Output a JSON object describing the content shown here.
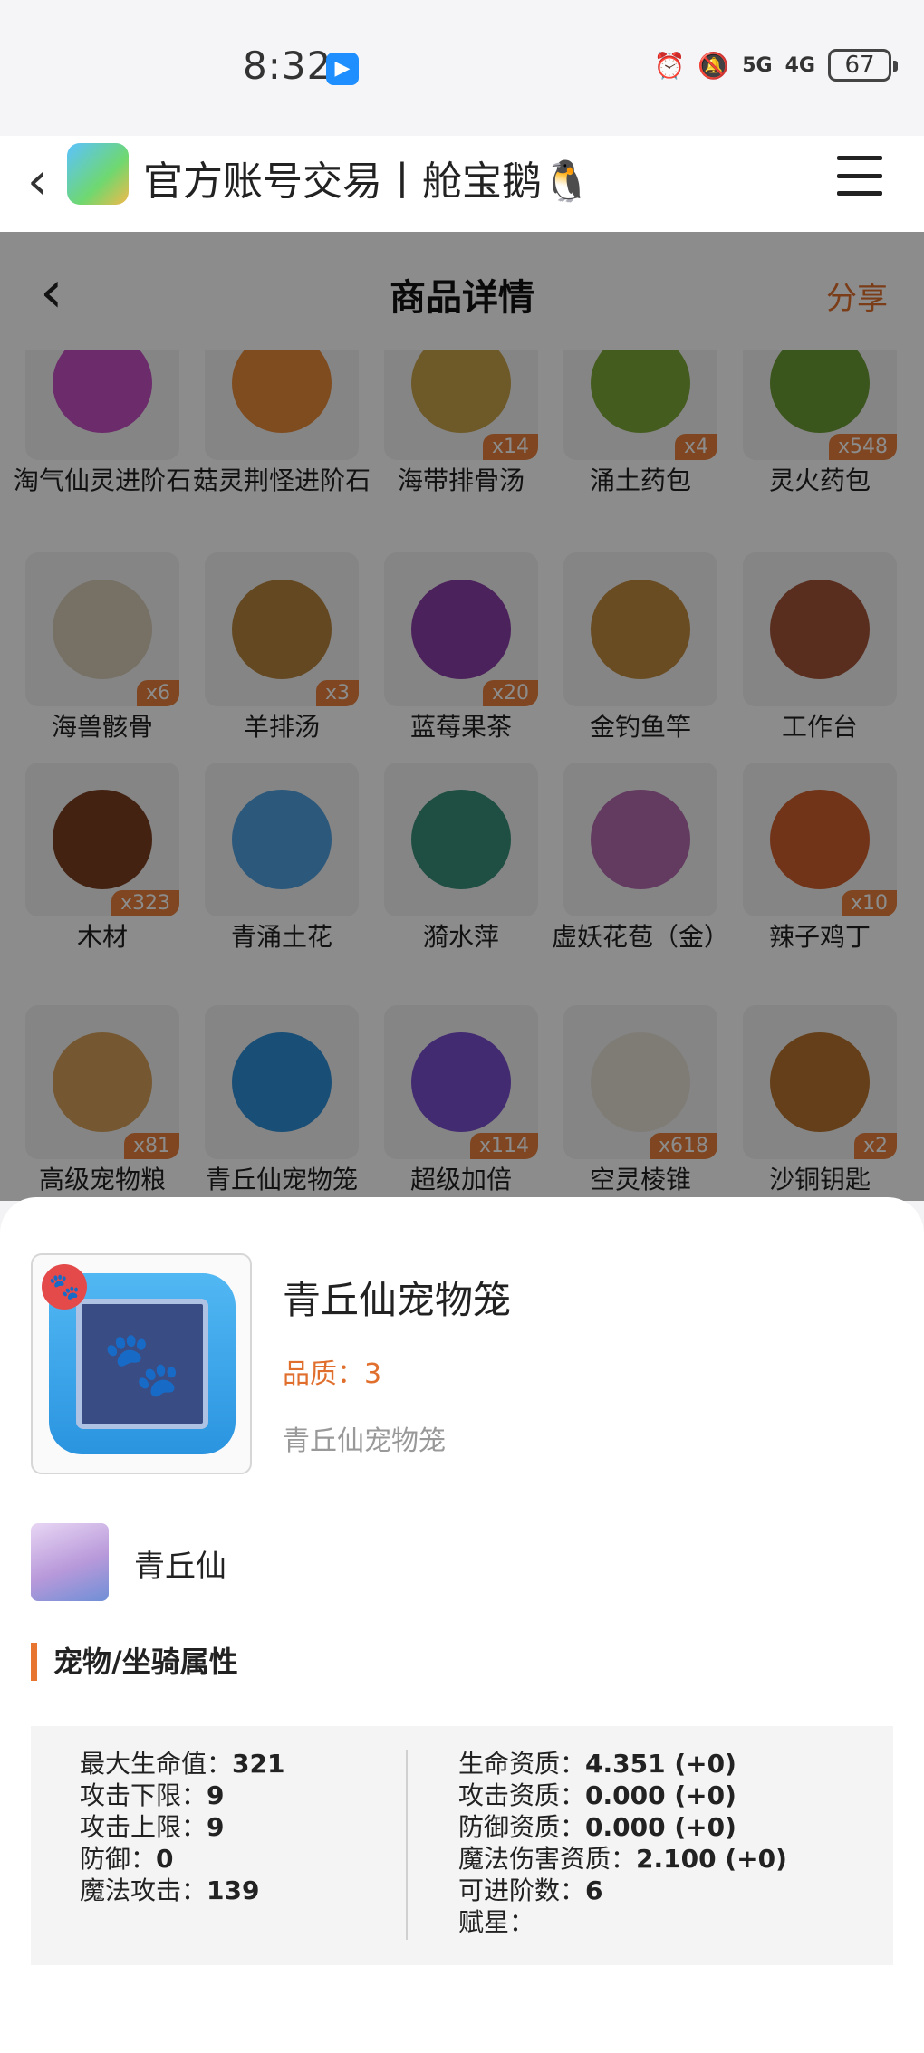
{
  "status_bar": {
    "time": "8:32",
    "signal_5g": "5G",
    "signal_4g": "4G",
    "battery": "67"
  },
  "app_header": {
    "title": "官方账号交易丨舱宝鹅🐧"
  },
  "nav": {
    "title": "商品详情",
    "share": "分享"
  },
  "grid_items": [
    {
      "name": "淘气仙灵进阶石",
      "qty": "",
      "color": "#c54fc4"
    },
    {
      "name": "菇灵荆怪进阶石",
      "qty": "",
      "color": "#e88a3a"
    },
    {
      "name": "海带排骨汤",
      "qty": "x14",
      "color": "#c8a24a"
    },
    {
      "name": "涌土药包",
      "qty": "x4",
      "color": "#7ea83a"
    },
    {
      "name": "灵火药包",
      "qty": "x548",
      "color": "#6c9d35"
    },
    {
      "name": "海兽骸骨",
      "qty": "x6",
      "color": "#d8cdb8"
    },
    {
      "name": "羊排汤",
      "qty": "x3",
      "color": "#b5843c"
    },
    {
      "name": "蓝莓果茶",
      "qty": "x20",
      "color": "#8a3fa8"
    },
    {
      "name": "金钓鱼竿",
      "qty": "",
      "color": "#c18a3f"
    },
    {
      "name": "工作台",
      "qty": "",
      "color": "#a5543a"
    },
    {
      "name": "木材",
      "qty": "x323",
      "color": "#7a3f22"
    },
    {
      "name": "青涌土花",
      "qty": "",
      "color": "#4fa0e0"
    },
    {
      "name": "漪水萍",
      "qty": "",
      "color": "#3a8f7a"
    },
    {
      "name": "虚妖花苞（金）",
      "qty": "",
      "color": "#b56ab0"
    },
    {
      "name": "辣子鸡丁",
      "qty": "x10",
      "color": "#d0602c"
    },
    {
      "name": "高级宠物粮",
      "qty": "x81",
      "color": "#d6a05a"
    },
    {
      "name": "青丘仙宠物笼",
      "qty": "",
      "color": "#2f8fd8"
    },
    {
      "name": "超级加倍",
      "qty": "x114",
      "color": "#7b4fd0"
    },
    {
      "name": "空灵棱锥",
      "qty": "x618",
      "color": "#e8e2d8"
    },
    {
      "name": "沙铜钥匙",
      "qty": "x2",
      "color": "#b8742f"
    }
  ],
  "detail": {
    "name": "青丘仙宠物笼",
    "quality": "品质：3",
    "description": "青丘仙宠物笼",
    "paw_glyph": "🐾",
    "pet_name": "青丘仙",
    "section_title": "宠物/坐骑属性",
    "left_attrs": [
      {
        "label": "最大生命值：",
        "value": "321"
      },
      {
        "label": "攻击下限：",
        "value": "9"
      },
      {
        "label": "攻击上限：",
        "value": "9"
      },
      {
        "label": "防御：",
        "value": "0"
      },
      {
        "label": "魔法攻击：",
        "value": "139"
      }
    ],
    "right_attrs": [
      {
        "label": "生命资质：",
        "value": "4.351 (+0)"
      },
      {
        "label": "攻击资质：",
        "value": "0.000 (+0)"
      },
      {
        "label": "防御资质：",
        "value": "0.000 (+0)"
      },
      {
        "label": "魔法伤害资质：",
        "value": "2.100 (+0)"
      },
      {
        "label": "可进阶数：",
        "value": "6"
      },
      {
        "label": "赋星：",
        "value": ""
      }
    ]
  }
}
